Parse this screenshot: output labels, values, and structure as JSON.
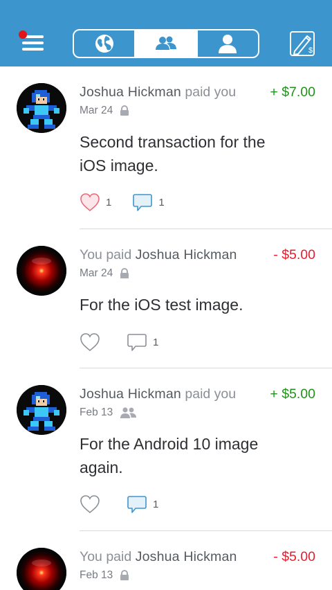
{
  "topbar": {
    "menu_icon": "hamburger-icon",
    "notification_color": "#e0151a",
    "tabs": [
      {
        "name": "globe",
        "icon": "globe-icon",
        "active": false
      },
      {
        "name": "friends",
        "icon": "friends-icon",
        "active": true
      },
      {
        "name": "me",
        "icon": "person-icon",
        "active": false
      }
    ],
    "pay_icon": "pay-request-icon",
    "brand_color": "#3d95ce"
  },
  "feed": [
    {
      "actor": "Joshua Hickman",
      "verb": "paid",
      "target": "you",
      "amount": "+ $7.00",
      "amount_kind": "positive",
      "date": "Mar 24",
      "privacy_icon": "lock-icon",
      "note_line1": "Second transaction for the",
      "note_line2": "iOS image.",
      "likes": "1",
      "comments": "1",
      "liked": true,
      "commented": true,
      "avatar": "megaman-avatar"
    },
    {
      "actor": "You",
      "verb": "paid",
      "target": "Joshua Hickman",
      "amount": "- $5.00",
      "amount_kind": "negative",
      "date": "Mar 24",
      "privacy_icon": "lock-icon",
      "note_line1": "For the iOS test image.",
      "note_line2": "",
      "likes": "",
      "comments": "1",
      "liked": false,
      "commented": false,
      "avatar": "hal-eye-avatar"
    },
    {
      "actor": "Joshua Hickman",
      "verb": "paid",
      "target": "you",
      "amount": "+ $5.00",
      "amount_kind": "positive",
      "date": "Feb 13",
      "privacy_icon": "friends-icon",
      "note_line1": "For the Android 10 image",
      "note_line2": "again.",
      "likes": "",
      "comments": "1",
      "liked": false,
      "commented": true,
      "avatar": "megaman-avatar"
    },
    {
      "actor": "You",
      "verb": "paid",
      "target": "Joshua Hickman",
      "amount": "- $5.00",
      "amount_kind": "negative",
      "date": "Feb 13",
      "privacy_icon": "lock-icon",
      "avatar": "hal-eye-avatar"
    }
  ],
  "colors": {
    "positive": "#21911b",
    "negative": "#e0212f",
    "like_active": "#e86b7b",
    "comment_active": "#3d95ce"
  }
}
